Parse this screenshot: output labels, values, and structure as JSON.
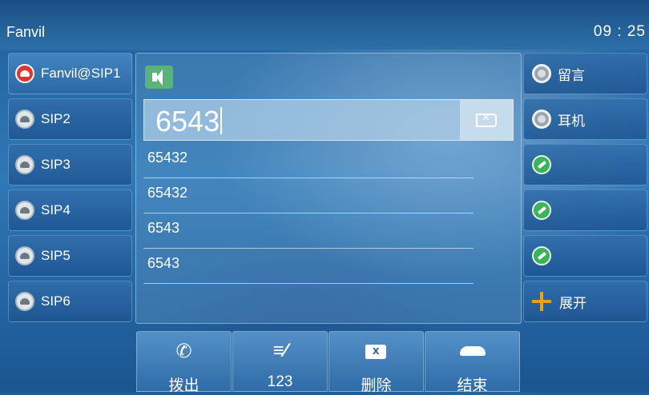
{
  "header": {
    "title": "Fanvil",
    "time": "09 : 25"
  },
  "lines": [
    {
      "label": "Fanvil@SIP1",
      "icon": "phone-red-icon"
    },
    {
      "label": "SIP2",
      "icon": "phone-gray-icon"
    },
    {
      "label": "SIP3",
      "icon": "phone-gray-icon"
    },
    {
      "label": "SIP4",
      "icon": "phone-gray-icon"
    },
    {
      "label": "SIP5",
      "icon": "phone-gray-icon"
    },
    {
      "label": "SIP6",
      "icon": "phone-gray-icon"
    }
  ],
  "dial": {
    "value": "6543"
  },
  "suggestions": [
    "65432",
    "65432",
    "6543",
    "6543"
  ],
  "right_keys": [
    {
      "label": "留言",
      "icon": "radio-icon"
    },
    {
      "label": "耳机",
      "icon": "radio-icon"
    },
    {
      "label": "",
      "icon": "edit-icon"
    },
    {
      "label": "",
      "icon": "edit-icon"
    },
    {
      "label": "",
      "icon": "edit-icon"
    },
    {
      "label": "展开",
      "icon": "move-icon"
    }
  ],
  "softkeys": [
    {
      "label": "拨出",
      "icon": "phone-handset-icon"
    },
    {
      "label": "123",
      "icon": "input-method-icon"
    },
    {
      "label": "删除",
      "icon": "backspace-icon"
    },
    {
      "label": "结束",
      "icon": "hangup-icon"
    }
  ]
}
